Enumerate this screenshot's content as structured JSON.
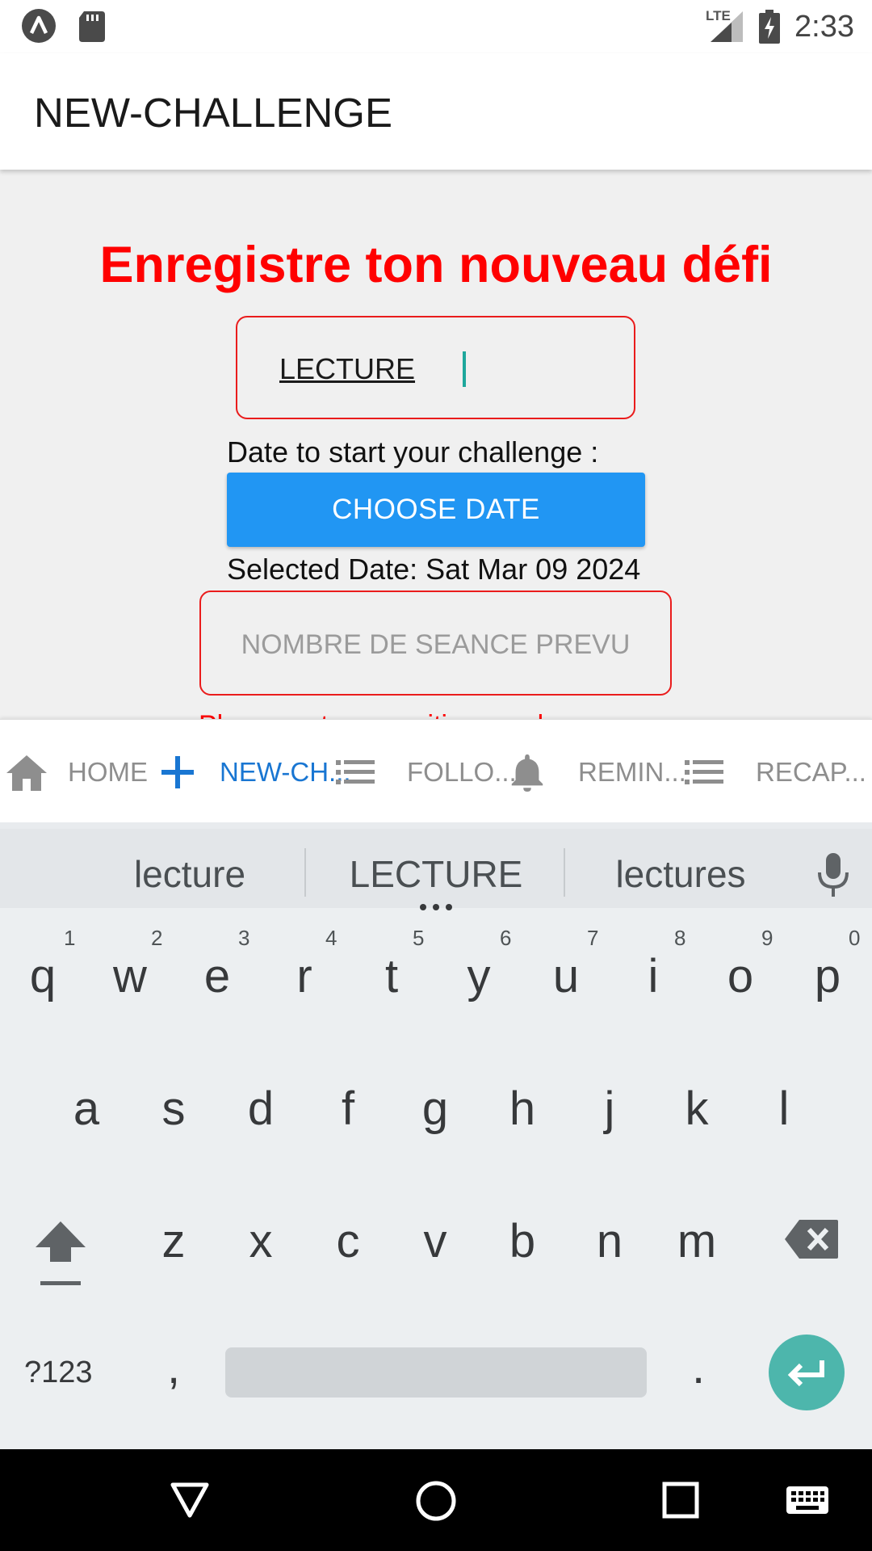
{
  "status_bar": {
    "time": "2:33",
    "network": "LTE",
    "icons": [
      "app-launcher-icon",
      "sd-card-icon",
      "signal-icon",
      "battery-charging-icon"
    ]
  },
  "app_bar": {
    "title": "NEW-CHALLENGE"
  },
  "form": {
    "headline": "Enregistre ton nouveau défi",
    "challenge_value": "LECTURE",
    "date_label": "Date to start your challenge :",
    "choose_date_label": "CHOOSE DATE",
    "selected_date": "Selected Date: Sat Mar 09 2024",
    "seances_placeholder": "NOMBRE DE SEANCE PREVU",
    "error_text_partial": "Please enter a positive number"
  },
  "tabs": [
    {
      "label": "HOME",
      "icon": "home-icon",
      "active": false
    },
    {
      "label": "NEW-CH...",
      "icon": "plus-icon",
      "active": true
    },
    {
      "label": "FOLLO...",
      "icon": "list-icon",
      "active": false
    },
    {
      "label": "REMIN...",
      "icon": "bell-icon",
      "active": false
    },
    {
      "label": "RECAP...",
      "icon": "list-icon",
      "active": false
    }
  ],
  "keyboard": {
    "suggestions": [
      "lecture",
      "LECTURE",
      "lectures"
    ],
    "row1": [
      "q",
      "w",
      "e",
      "r",
      "t",
      "y",
      "u",
      "i",
      "o",
      "p"
    ],
    "row1_hints": [
      "1",
      "2",
      "3",
      "4",
      "5",
      "6",
      "7",
      "8",
      "9",
      "0"
    ],
    "row2": [
      "a",
      "s",
      "d",
      "f",
      "g",
      "h",
      "j",
      "k",
      "l"
    ],
    "row3": [
      "z",
      "x",
      "c",
      "v",
      "b",
      "n",
      "m"
    ],
    "symbols_key": "?123",
    "comma_key": ",",
    "period_key": "."
  },
  "colors": {
    "accent_red": "#ff0000",
    "button_blue": "#2196f3",
    "active_tab_blue": "#1976d2",
    "enter_teal": "#4db6ac"
  }
}
